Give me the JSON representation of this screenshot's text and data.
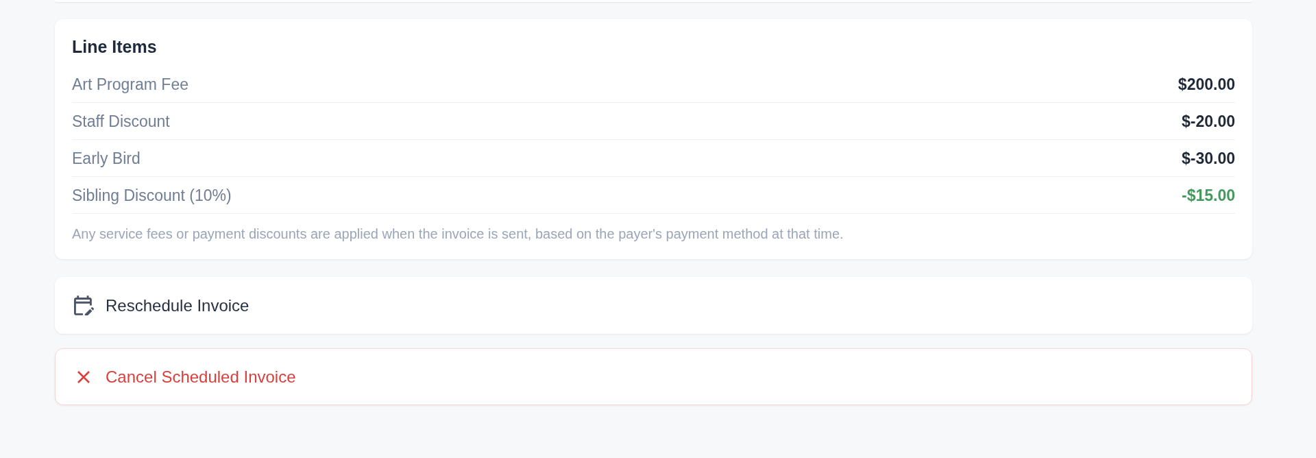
{
  "line_items": {
    "title": "Line Items",
    "items": [
      {
        "label": "Art Program Fee",
        "amount": "$200.00",
        "color": "#1f2937"
      },
      {
        "label": "Staff Discount",
        "amount": "$-20.00",
        "color": "#1f2937"
      },
      {
        "label": "Early Bird",
        "amount": "$-30.00",
        "color": "#1f2937"
      },
      {
        "label": "Sibling Discount (10%)",
        "amount": "-$15.00",
        "color": "#439a5c"
      }
    ],
    "note": "Any service fees or payment discounts are applied when the invoice is sent, based on the payer's payment method at that time."
  },
  "actions": [
    {
      "kind": "neutral",
      "label": "Reschedule Invoice"
    },
    {
      "kind": "danger",
      "label": "Cancel Scheduled Invoice"
    }
  ]
}
